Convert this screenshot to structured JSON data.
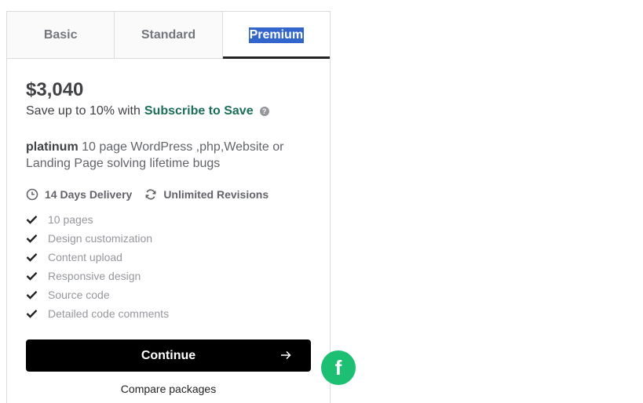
{
  "tabs": [
    {
      "label": "Basic"
    },
    {
      "label": "Standard"
    },
    {
      "label": "Premium"
    }
  ],
  "package": {
    "price": "$3,040",
    "save_prefix": "Save up to 10% with",
    "save_link": "Subscribe to Save",
    "help_glyph": "?",
    "title": "platinum",
    "description": " 10 page WordPress ,php,Website or Landing Page solving lifetime bugs",
    "delivery": "14 Days Delivery",
    "revisions": "Unlimited Revisions",
    "features": [
      "10 pages",
      "Design customization",
      "Content upload",
      "Responsive design",
      "Source code",
      "Detailed code comments"
    ]
  },
  "actions": {
    "continue_label": "Continue",
    "compare_label": "Compare packages"
  },
  "fab": {
    "glyph": "f"
  },
  "colors": {
    "accent_green": "#1c6f56",
    "fab_green": "#1dbf73",
    "selection_blue": "#3366cc",
    "button_black": "#000000"
  }
}
